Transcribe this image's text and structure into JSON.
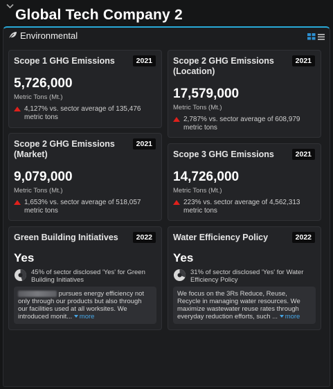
{
  "header": {
    "company_name": "Global Tech Company 2"
  },
  "panel": {
    "title": "Environmental"
  },
  "cards": {
    "scope1": {
      "title": "Scope 1 GHG Emissions",
      "year": "2021",
      "value": "5,726,000",
      "unit": "Metric Tons (Mt.)",
      "compare": "4,127% vs. sector average of 135,476 metric tons"
    },
    "scope2_location": {
      "title": "Scope 2 GHG Emissions (Location)",
      "year": "2021",
      "value": "17,579,000",
      "unit": "Metric Tons (Mt.)",
      "compare": "2,787% vs. sector average of 608,979 metric tons"
    },
    "scope2_market": {
      "title": "Scope 2 GHG Emissions (Market)",
      "year": "2021",
      "value": "9,079,000",
      "unit": "Metric Tons (Mt.)",
      "compare": "1,653% vs. sector average of 518,057 metric tons"
    },
    "scope3": {
      "title": "Scope 3 GHG Emissions",
      "year": "2021",
      "value": "14,726,000",
      "unit": "Metric Tons (Mt.)",
      "compare": "223% vs. sector average of 4,562,313 metric tons"
    },
    "green_building": {
      "title": "Green Building Initiatives",
      "year": "2022",
      "value": "Yes",
      "disclosed": "45% of sector disclosed 'Yes' for Green Building Initiatives",
      "disclosed_fraction": 0.45,
      "description": "pursues energy efficiency not only through our products but also through our facilities used at all worksites. We introduced monit...",
      "more_label": "more"
    },
    "water_efficiency": {
      "title": "Water Efficiency Policy",
      "year": "2022",
      "value": "Yes",
      "disclosed": "31% of sector disclosed 'Yes' for Water Efficiency Policy",
      "disclosed_fraction": 0.31,
      "description": "We focus on the 3Rs Reduce, Reuse, Recycle in managing water resources. We maximize wastewater reuse rates through everyday reduction efforts, such ...",
      "more_label": "more"
    }
  },
  "colors": {
    "accent": "#28a9d8",
    "negative_trend": "#e0201b",
    "link": "#47a6e6",
    "grid_icon": "#2d8fd0"
  },
  "icons": {
    "collapse": "chevron-down-icon",
    "section": "leaf-icon",
    "grid_view": "grid-view-icon",
    "list_view": "list-view-icon",
    "trend": "triangle-up-icon",
    "pie": "pie-chart-icon"
  }
}
